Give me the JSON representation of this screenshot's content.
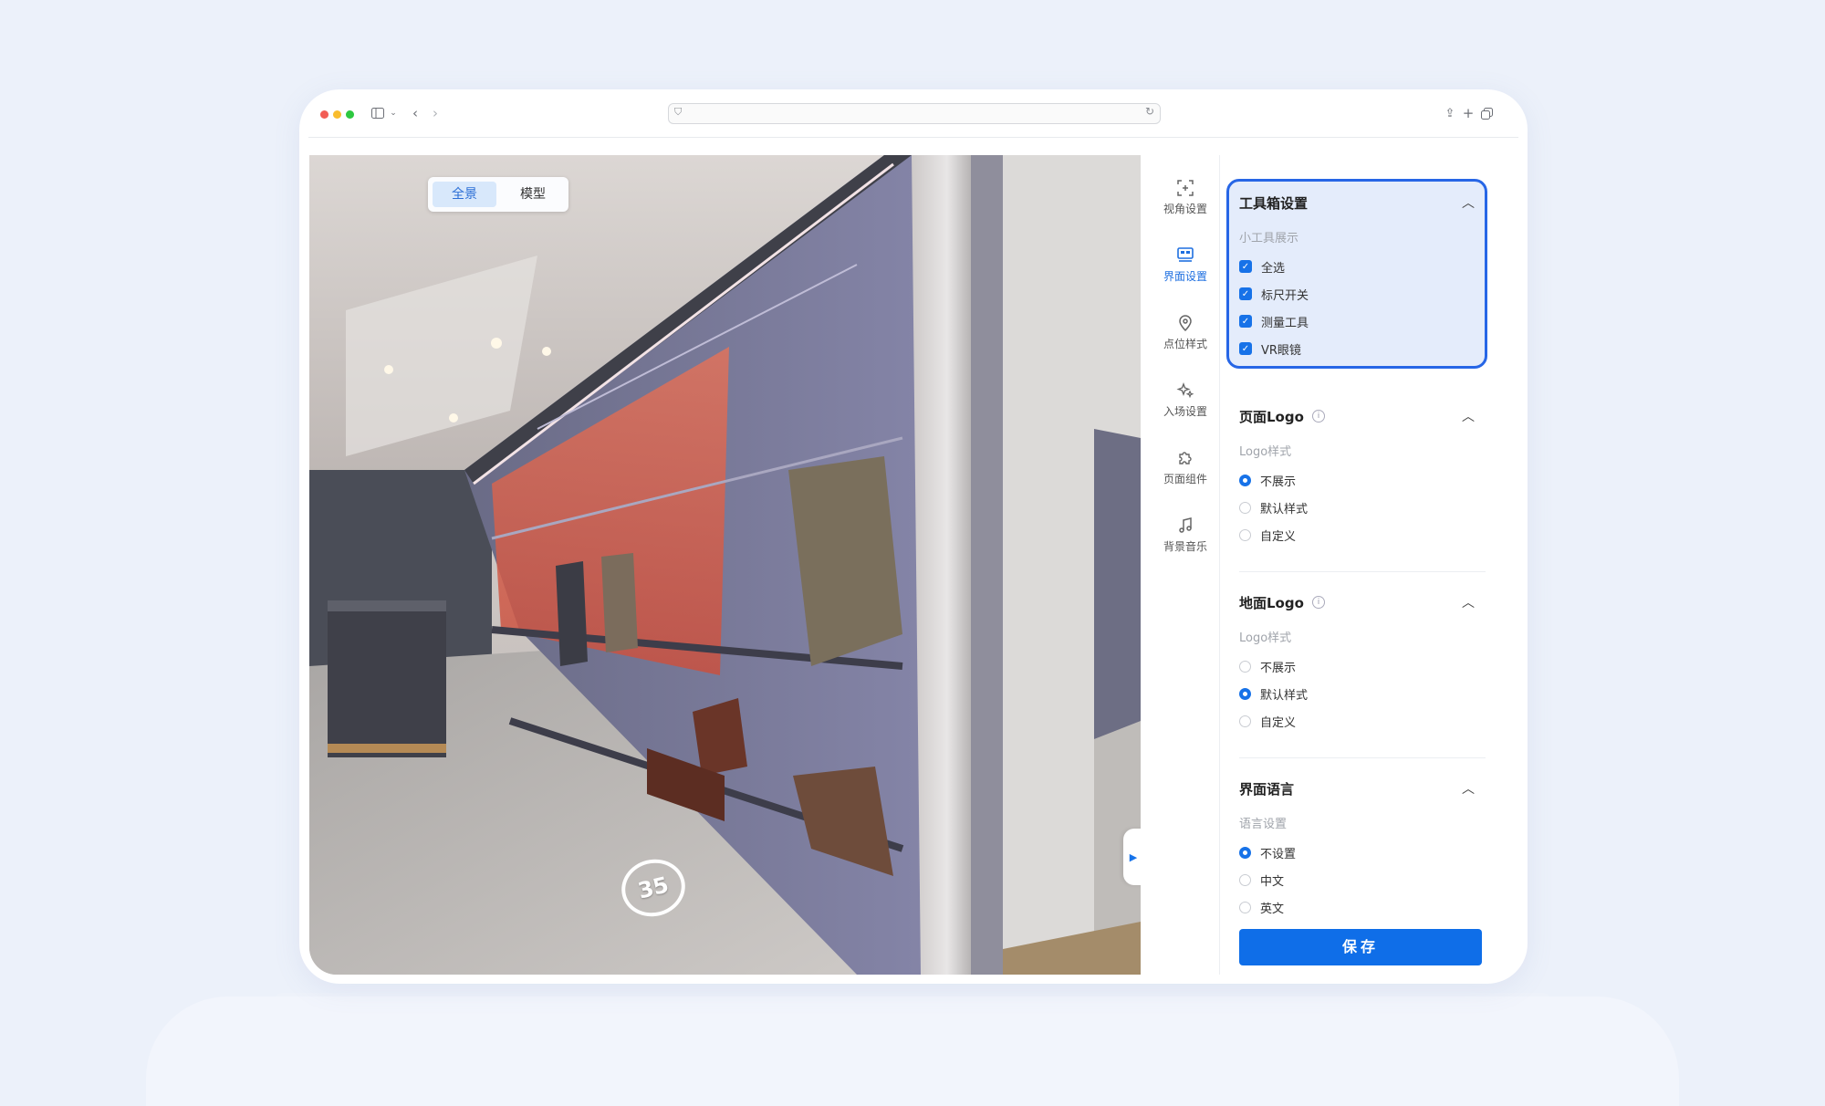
{
  "window": {
    "traffic_lights": [
      "#f25d55",
      "#f9bd2e",
      "#2dc840"
    ],
    "address": "",
    "icons": [
      "sidebar-icon",
      "chevron-down-icon",
      "back-icon",
      "forward-icon",
      "share-icon",
      "plus-icon",
      "tabs-icon"
    ]
  },
  "viewer": {
    "view_tabs": [
      "全景",
      "模型"
    ],
    "active_tab": "全景",
    "hotspot_number": "35"
  },
  "nav": [
    {
      "label": "视角设置",
      "icon": "view-angle-icon"
    },
    {
      "label": "界面设置",
      "icon": "interface-icon",
      "active": true
    },
    {
      "label": "点位样式",
      "icon": "location-pin-icon"
    },
    {
      "label": "入场设置",
      "icon": "sparkle-icon"
    },
    {
      "label": "页面组件",
      "icon": "puzzle-icon"
    },
    {
      "label": "背景音乐",
      "icon": "music-note-icon"
    }
  ],
  "toolbox": {
    "title": "工具箱设置",
    "subtitle": "小工具展示",
    "options": [
      "全选",
      "标尺开关",
      "测量工具",
      "VR眼镜"
    ],
    "checked": [
      true,
      true,
      true,
      true
    ]
  },
  "page_logo": {
    "title": "页面Logo",
    "subtitle": "Logo样式",
    "options": [
      "不展示",
      "默认样式",
      "自定义"
    ],
    "selected": "不展示"
  },
  "ground_logo": {
    "title": "地面Logo",
    "subtitle": "Logo样式",
    "options": [
      "不展示",
      "默认样式",
      "自定义"
    ],
    "selected": "默认样式"
  },
  "language": {
    "title": "界面语言",
    "subtitle": "语言设置",
    "options": [
      "不设置",
      "中文",
      "英文"
    ],
    "selected": "不设置"
  },
  "save_label": "保存",
  "colors": {
    "accent": "#1772e8",
    "highlight_border": "#2766e6",
    "highlight_bg": "#e4ecfb"
  }
}
